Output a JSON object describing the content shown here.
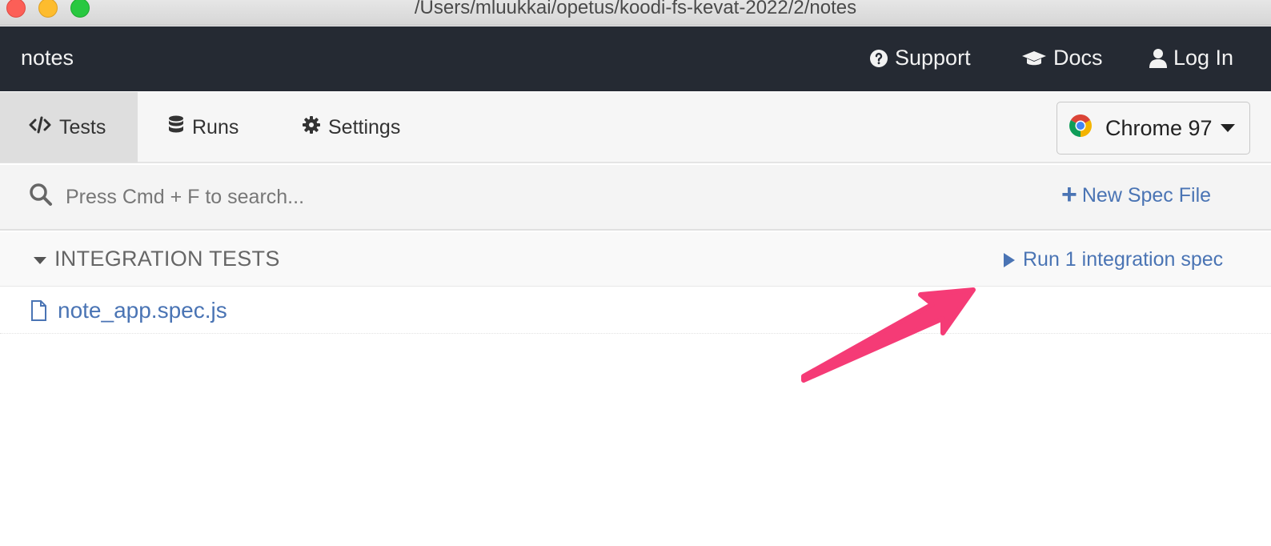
{
  "window": {
    "title": "/Users/mluukkai/opetus/koodi-fs-kevat-2022/2/notes"
  },
  "topnav": {
    "project_name": "notes",
    "links": [
      {
        "label": "Support",
        "icon": "question-circle-icon"
      },
      {
        "label": "Docs",
        "icon": "graduation-cap-icon"
      },
      {
        "label": "Log In",
        "icon": "user-icon"
      }
    ]
  },
  "tabs": [
    {
      "label": "Tests",
      "icon": "code-icon",
      "active": true
    },
    {
      "label": "Runs",
      "icon": "database-icon",
      "active": false
    },
    {
      "label": "Settings",
      "icon": "gear-icon",
      "active": false
    }
  ],
  "browser": {
    "selected": "Chrome 97",
    "icon": "chrome-logo-icon"
  },
  "search": {
    "placeholder": "Press Cmd + F to search...",
    "value": ""
  },
  "new_spec": {
    "label": "New Spec File"
  },
  "integration": {
    "title": "INTEGRATION TESTS",
    "run_label": "Run 1 integration spec",
    "specs": [
      {
        "name": "note_app.spec.js"
      }
    ]
  },
  "colors": {
    "nav_bg": "#252a33",
    "link_blue": "#4a74b4",
    "annotation_arrow": "#f53b76"
  }
}
